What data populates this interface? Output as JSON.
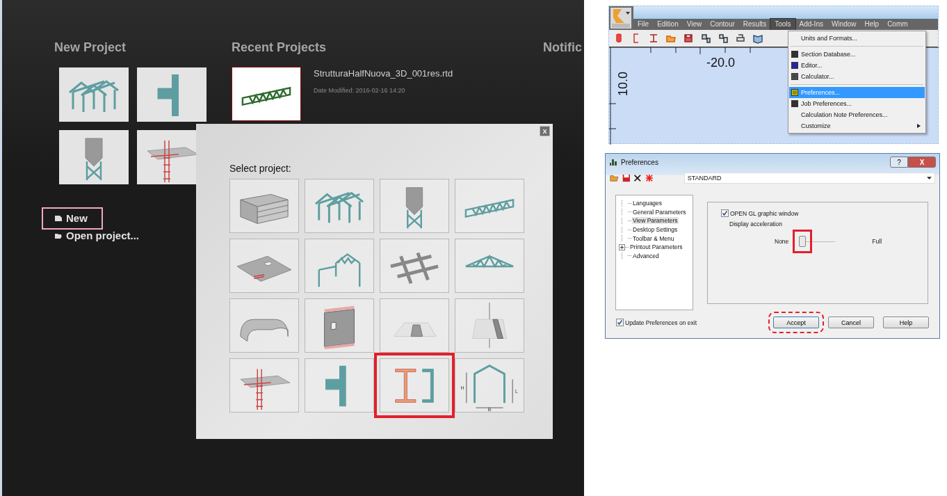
{
  "start_page": {
    "new_project": {
      "title": "New Project",
      "tiles": [
        {
          "kind": "frame"
        },
        {
          "kind": "joint"
        },
        {
          "kind": "silo"
        },
        {
          "kind": "rebar-column"
        }
      ]
    },
    "actions": [
      {
        "label": "New",
        "kind": "new",
        "highlighted": true
      },
      {
        "label": "Open project...",
        "kind": "open",
        "highlighted": false
      }
    ],
    "recent_projects": {
      "title": "Recent Projects",
      "items": [
        {
          "name": "StrutturaHalfNuova_3D_001res.rtd",
          "date": "Date Modified: 2016-02-16 14:20",
          "kind": "truss"
        }
      ]
    },
    "notifications": {
      "title": "Notific"
    }
  },
  "select_dialog": {
    "close": "X",
    "title": "Select project:",
    "tiles": [
      {
        "kind": "building",
        "selected": false
      },
      {
        "kind": "frame",
        "selected": false
      },
      {
        "kind": "silo",
        "selected": false
      },
      {
        "kind": "truss",
        "selected": false
      },
      {
        "kind": "slab",
        "selected": false
      },
      {
        "kind": "portal-truss",
        "selected": false
      },
      {
        "kind": "grid",
        "selected": false
      },
      {
        "kind": "roof-truss",
        "selected": false
      },
      {
        "kind": "curved-wall",
        "selected": false
      },
      {
        "kind": "wall",
        "selected": false
      },
      {
        "kind": "solid",
        "selected": false
      },
      {
        "kind": "cone",
        "selected": false
      },
      {
        "kind": "rebar-column",
        "selected": false
      },
      {
        "kind": "joint",
        "selected": false
      },
      {
        "kind": "sections",
        "selected": true
      },
      {
        "kind": "profile",
        "selected": false,
        "labels": [
          "H",
          "L",
          "B"
        ]
      }
    ]
  },
  "app_window": {
    "menu": [
      {
        "label": "File",
        "selected": false
      },
      {
        "label": "Edition",
        "selected": false
      },
      {
        "label": "View",
        "selected": false
      },
      {
        "label": "Contour",
        "selected": false
      },
      {
        "label": "Results",
        "selected": false
      },
      {
        "label": "Tools",
        "selected": true
      },
      {
        "label": "Add-Ins",
        "selected": false
      },
      {
        "label": "Window",
        "selected": false
      },
      {
        "label": "Help",
        "selected": false
      },
      {
        "label": "Comm",
        "selected": false
      }
    ],
    "ruler": {
      "x_label": "-20.0",
      "y_label": "10.0"
    },
    "tools_menu": [
      {
        "label": "Units and Formats...",
        "kind": "plain",
        "selected": false
      },
      {
        "kind": "separator"
      },
      {
        "label": "Section Database...",
        "kind": "icon",
        "selected": false
      },
      {
        "label": "Editor...",
        "kind": "icon",
        "selected": false
      },
      {
        "label": "Calculator...",
        "kind": "icon",
        "selected": false
      },
      {
        "kind": "separator"
      },
      {
        "label": "Preferences...",
        "kind": "icon",
        "selected": true
      },
      {
        "label": "Job Preferences...",
        "kind": "icon",
        "selected": false
      },
      {
        "label": "Calculation Note Preferences...",
        "kind": "plain",
        "selected": false
      },
      {
        "label": "Customize",
        "kind": "submenu",
        "selected": false
      }
    ]
  },
  "preferences": {
    "title": "Preferences",
    "help": "?",
    "close": "X",
    "profile": "STANDARD",
    "tree": [
      {
        "label": "Languages",
        "selected": false
      },
      {
        "label": "General Parameters",
        "selected": false
      },
      {
        "label": "View Parameters",
        "selected": true
      },
      {
        "label": "Desktop Settings",
        "selected": false
      },
      {
        "label": "Toolbar & Menu",
        "selected": false
      },
      {
        "label": "Printout Parameters",
        "selected": false,
        "expanded": false
      },
      {
        "label": "Advanced",
        "selected": false
      }
    ],
    "opengl": {
      "label": "OPEN GL graphic window",
      "checked": true
    },
    "acceleration": {
      "label": "Display acceleration",
      "min_label": "None",
      "max_label": "Full",
      "level": 0,
      "highlighted": true
    },
    "update_on_exit": {
      "label": "Update Preferences on exit",
      "checked": true
    },
    "buttons": [
      {
        "label": "Accept",
        "highlighted": true
      },
      {
        "label": "Cancel",
        "highlighted": false
      },
      {
        "label": "Help",
        "highlighted": false
      }
    ]
  }
}
